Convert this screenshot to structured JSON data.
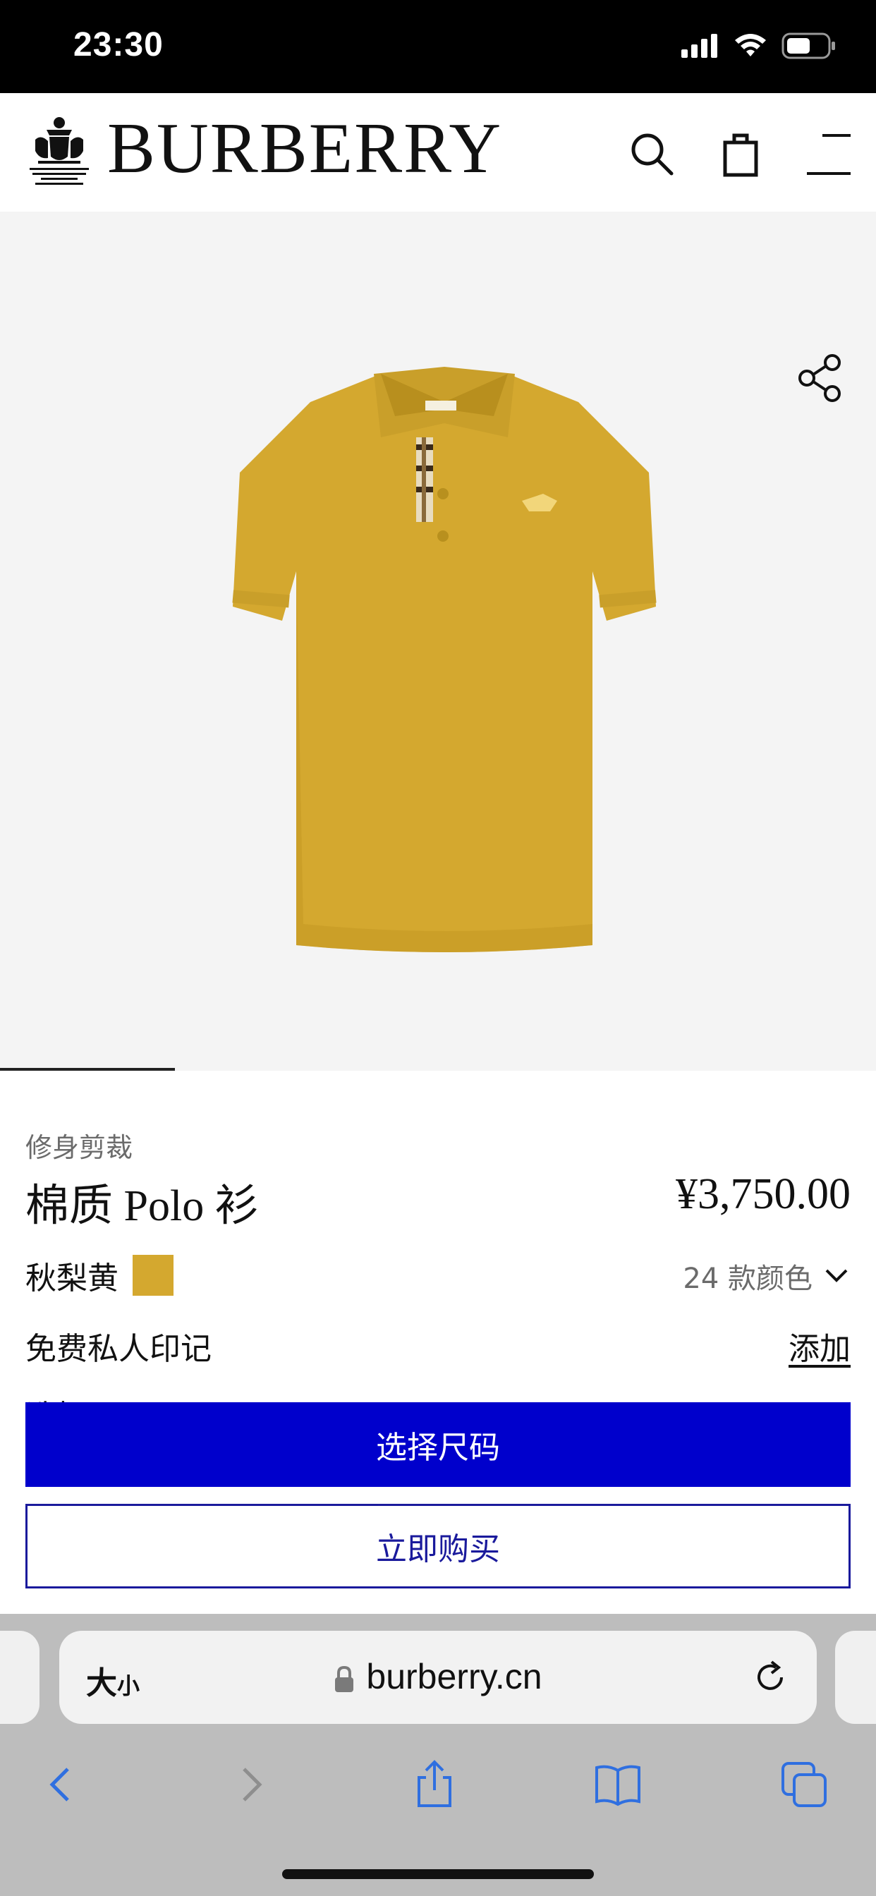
{
  "status_bar": {
    "time": "23:30",
    "icons": [
      "signal-icon",
      "wifi-icon",
      "battery-icon"
    ]
  },
  "header": {
    "brand": "BURBERRY",
    "icons": [
      "royal-crest-icon",
      "search-icon",
      "shopping-bag-icon",
      "menu-icon"
    ]
  },
  "product": {
    "image": "yellow-polo-shirt",
    "fit": "修身剪裁",
    "title": "棉质 Polo 衫",
    "price": "¥3,750.00",
    "color_name": "秋梨黄",
    "color_hex": "#d4a82f",
    "color_count": "24 款颜色",
    "engraving_label": "免费私人印记",
    "engraving_action": "添加",
    "partial_text": "选择尺码",
    "primary_button": "选择尺码",
    "secondary_button": "立即购买"
  },
  "colors": {
    "primary_blue": "#0000cc",
    "outline_blue": "#1a1a9c",
    "image_bg": "#f4f4f4"
  },
  "browser": {
    "text_size_label": "大",
    "text_size_small": "小",
    "url": "burberry.cn",
    "toolbar_icons": [
      "back-icon",
      "forward-icon",
      "share-icon",
      "bookmarks-icon",
      "tabs-icon"
    ]
  }
}
